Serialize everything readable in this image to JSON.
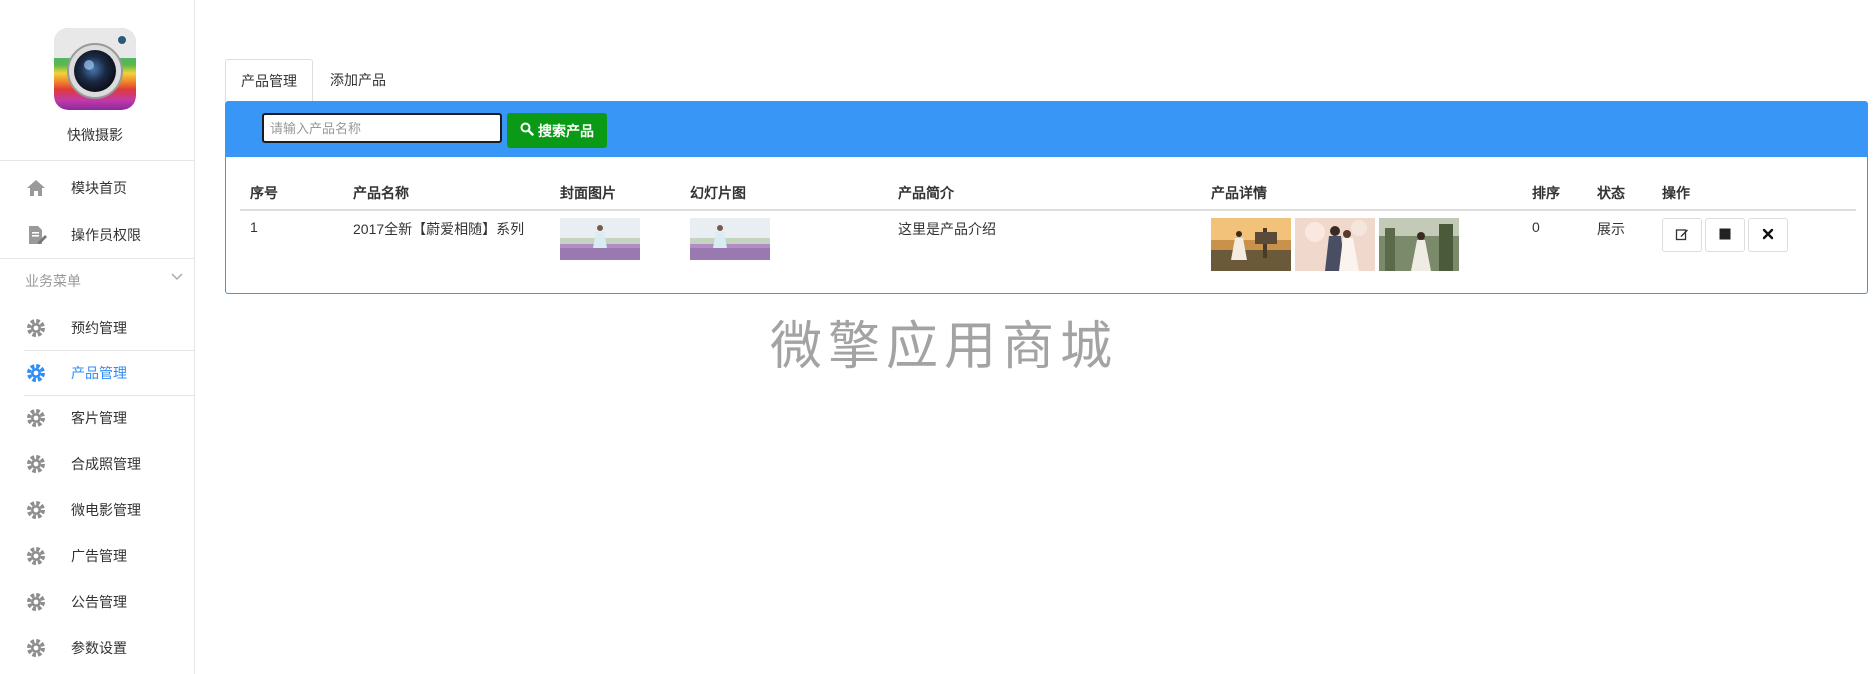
{
  "app": {
    "name": "快微摄影"
  },
  "sidebar": {
    "top_items": [
      {
        "label": "模块首页",
        "icon": "home-icon"
      },
      {
        "label": "操作员权限",
        "icon": "document-edit-icon"
      }
    ],
    "group_label": "业务菜单",
    "items": [
      {
        "label": "预约管理",
        "icon": "gear-icon"
      },
      {
        "label": "产品管理",
        "icon": "gear-icon",
        "active": true
      },
      {
        "label": "客片管理",
        "icon": "gear-icon"
      },
      {
        "label": "合成照管理",
        "icon": "gear-icon"
      },
      {
        "label": "微电影管理",
        "icon": "gear-icon"
      },
      {
        "label": "广告管理",
        "icon": "gear-icon"
      },
      {
        "label": "公告管理",
        "icon": "gear-icon"
      },
      {
        "label": "参数设置",
        "icon": "gear-icon"
      }
    ]
  },
  "tabs": [
    {
      "label": "产品管理",
      "active": true
    },
    {
      "label": "添加产品",
      "active": false
    }
  ],
  "search": {
    "placeholder": "请输入产品名称",
    "value": "",
    "button_label": "搜索产品"
  },
  "table": {
    "columns": [
      "序号",
      "产品名称",
      "封面图片",
      "幻灯片图",
      "产品简介",
      "产品详情",
      "排序",
      "状态",
      "操作"
    ],
    "rows": [
      {
        "index": "1",
        "name": "2017全新【蔚爱相随】系列",
        "intro": "这里是产品介绍",
        "sort": "0",
        "status": "展示"
      }
    ]
  },
  "colors": {
    "accent": "#3896f6",
    "search_button": "#0a9a16",
    "active_menu": "#2f8df5"
  },
  "watermark": "微擎应用商城"
}
